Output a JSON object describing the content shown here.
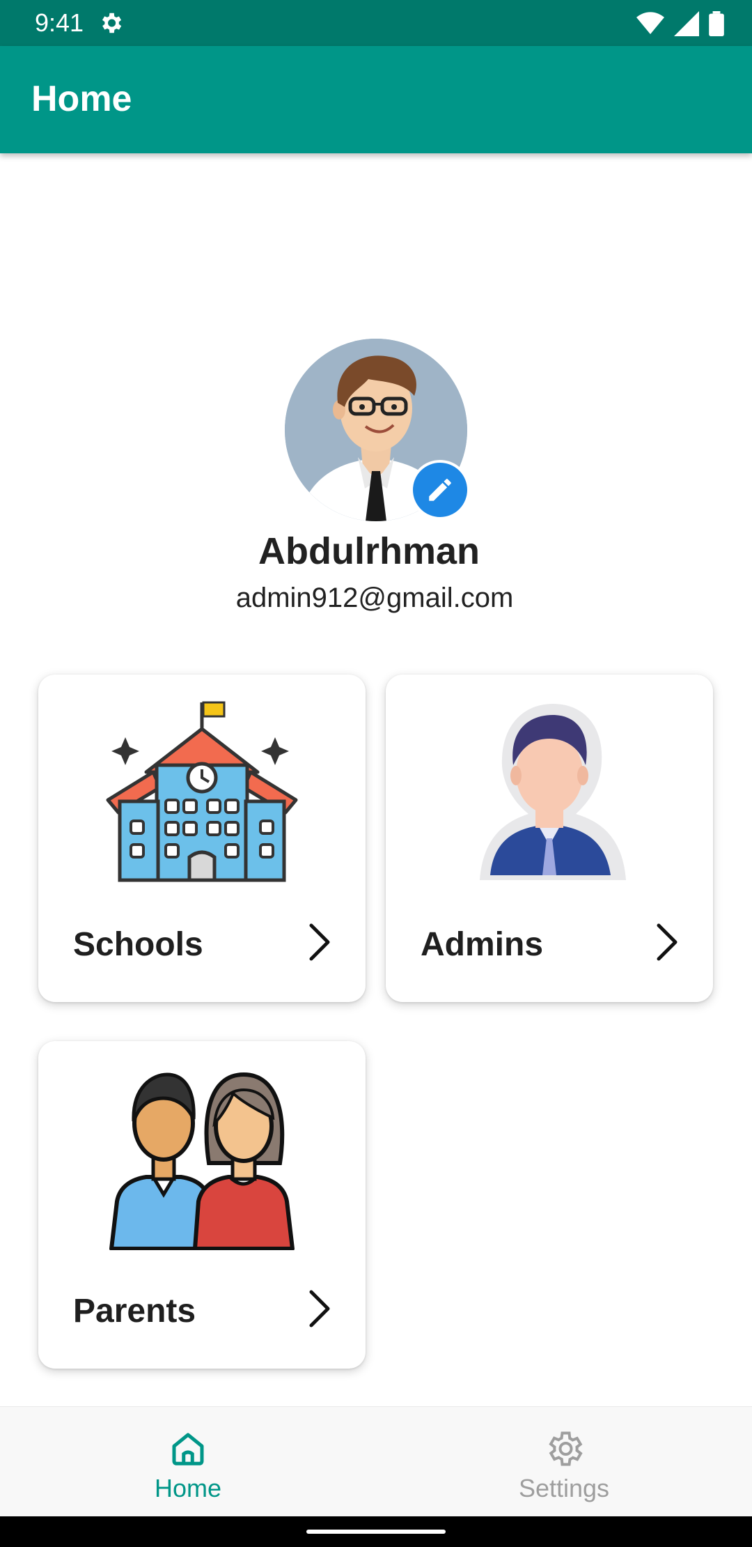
{
  "status": {
    "time": "9:41"
  },
  "appbar": {
    "title": "Home"
  },
  "profile": {
    "name": "Abdulrhman",
    "email": "admin912@gmail.com"
  },
  "cards": [
    {
      "label": "Schools"
    },
    {
      "label": "Admins"
    },
    {
      "label": "Parents"
    }
  ],
  "nav": {
    "home": "Home",
    "settings": "Settings"
  },
  "colors": {
    "primary": "#009688",
    "primary_dark": "#00796b",
    "edit_badge": "#1e88e5"
  }
}
